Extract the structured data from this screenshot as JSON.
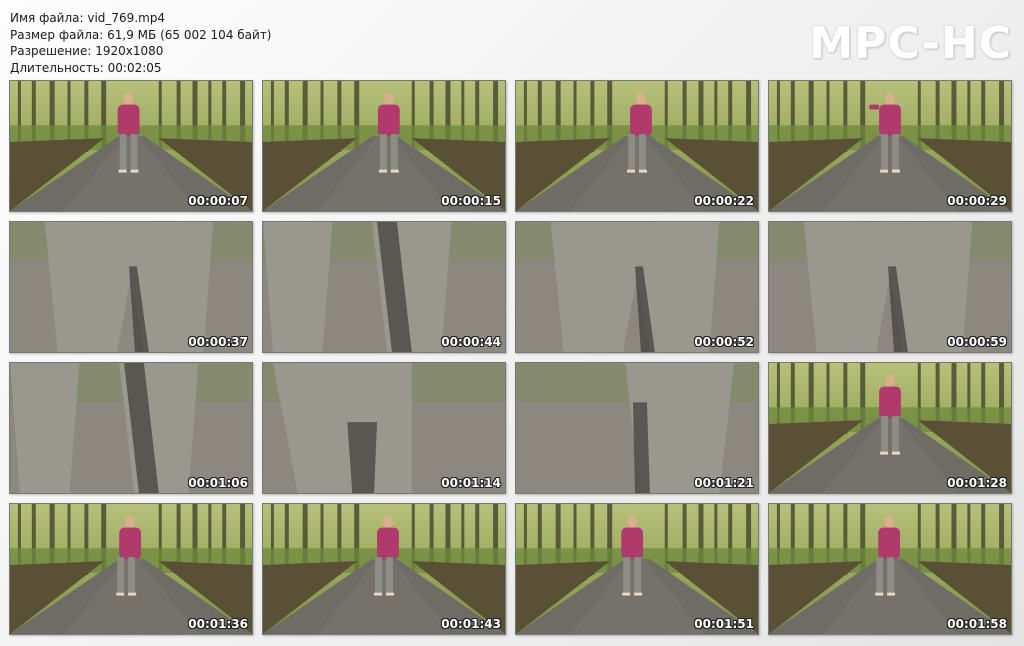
{
  "info": {
    "line1": "Имя файла: vid_769.mp4",
    "line2": "Размер файла: 61,9 МБ (65 002 104 байт)",
    "line3": "Разрешение: 1920x1080",
    "line4": "Длительность: 00:02:05"
  },
  "brand": "MPC-HC",
  "thumbnails": [
    {
      "time": "00:00:07",
      "scene": "forest-road",
      "person_x": 0.49,
      "pose": "standing"
    },
    {
      "time": "00:00:15",
      "scene": "forest-road",
      "person_x": 0.52,
      "pose": "standing"
    },
    {
      "time": "00:00:22",
      "scene": "forest-road",
      "person_x": 0.5,
      "pose": "bending"
    },
    {
      "time": "00:00:29",
      "scene": "forest-road",
      "person_x": 0.5,
      "pose": "waving"
    },
    {
      "time": "00:00:37",
      "scene": "closeup-front"
    },
    {
      "time": "00:00:44",
      "scene": "closeup-legs"
    },
    {
      "time": "00:00:52",
      "scene": "closeup-front"
    },
    {
      "time": "00:00:59",
      "scene": "closeup-front"
    },
    {
      "time": "00:01:06",
      "scene": "closeup-legs"
    },
    {
      "time": "00:01:14",
      "scene": "closeup-back"
    },
    {
      "time": "00:01:21",
      "scene": "closeup-side"
    },
    {
      "time": "00:01:28",
      "scene": "forest-road",
      "person_x": 0.5,
      "pose": "standing"
    },
    {
      "time": "00:01:36",
      "scene": "forest-road",
      "person_x": 0.48,
      "pose": "bending"
    },
    {
      "time": "00:01:43",
      "scene": "forest-road",
      "person_x": 0.5,
      "pose": "bending"
    },
    {
      "time": "00:01:51",
      "scene": "forest-road",
      "person_x": 0.48,
      "pose": "walking"
    },
    {
      "time": "00:01:58",
      "scene": "forest-road",
      "person_x": 0.48,
      "pose": "bending"
    }
  ],
  "colors": {
    "jacket": "#b03a6c",
    "pants": "#8e8c86",
    "road": "#6f6c66",
    "foliage": "#6f8a3c"
  }
}
